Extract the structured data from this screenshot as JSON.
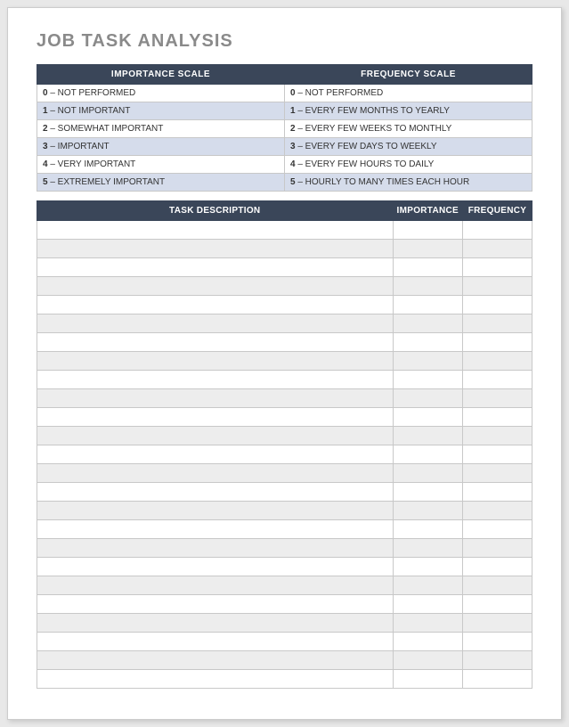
{
  "title": "JOB TASK ANALYSIS",
  "scales": {
    "importance_header": "IMPORTANCE SCALE",
    "frequency_header": "FREQUENCY SCALE",
    "rows": [
      {
        "imp_num": "0",
        "imp_text": " – NOT PERFORMED",
        "freq_num": "0",
        "freq_text": " – NOT PERFORMED",
        "alt": false
      },
      {
        "imp_num": "1",
        "imp_text": " – NOT IMPORTANT",
        "freq_num": "1",
        "freq_text": " – EVERY FEW MONTHS TO YEARLY",
        "alt": true
      },
      {
        "imp_num": "2",
        "imp_text": " – SOMEWHAT IMPORTANT",
        "freq_num": "2",
        "freq_text": " – EVERY FEW WEEKS TO MONTHLY",
        "alt": false
      },
      {
        "imp_num": "3",
        "imp_text": " – IMPORTANT",
        "freq_num": "3",
        "freq_text": " – EVERY FEW DAYS TO WEEKLY",
        "alt": true
      },
      {
        "imp_num": "4",
        "imp_text": " – VERY IMPORTANT",
        "freq_num": "4",
        "freq_text": " – EVERY FEW HOURS TO DAILY",
        "alt": false
      },
      {
        "imp_num": "5",
        "imp_text": " – EXTREMELY IMPORTANT",
        "freq_num": "5",
        "freq_text": " – HOURLY TO MANY TIMES EACH HOUR",
        "alt": true
      }
    ]
  },
  "tasks": {
    "header_desc": "TASK DESCRIPTION",
    "header_importance": "IMPORTANCE",
    "header_frequency": "FREQUENCY",
    "rows": [
      {
        "desc": "",
        "importance": "",
        "frequency": "",
        "alt": false
      },
      {
        "desc": "",
        "importance": "",
        "frequency": "",
        "alt": true
      },
      {
        "desc": "",
        "importance": "",
        "frequency": "",
        "alt": false
      },
      {
        "desc": "",
        "importance": "",
        "frequency": "",
        "alt": true
      },
      {
        "desc": "",
        "importance": "",
        "frequency": "",
        "alt": false
      },
      {
        "desc": "",
        "importance": "",
        "frequency": "",
        "alt": true
      },
      {
        "desc": "",
        "importance": "",
        "frequency": "",
        "alt": false
      },
      {
        "desc": "",
        "importance": "",
        "frequency": "",
        "alt": true
      },
      {
        "desc": "",
        "importance": "",
        "frequency": "",
        "alt": false
      },
      {
        "desc": "",
        "importance": "",
        "frequency": "",
        "alt": true
      },
      {
        "desc": "",
        "importance": "",
        "frequency": "",
        "alt": false
      },
      {
        "desc": "",
        "importance": "",
        "frequency": "",
        "alt": true
      },
      {
        "desc": "",
        "importance": "",
        "frequency": "",
        "alt": false
      },
      {
        "desc": "",
        "importance": "",
        "frequency": "",
        "alt": true
      },
      {
        "desc": "",
        "importance": "",
        "frequency": "",
        "alt": false
      },
      {
        "desc": "",
        "importance": "",
        "frequency": "",
        "alt": true
      },
      {
        "desc": "",
        "importance": "",
        "frequency": "",
        "alt": false
      },
      {
        "desc": "",
        "importance": "",
        "frequency": "",
        "alt": true
      },
      {
        "desc": "",
        "importance": "",
        "frequency": "",
        "alt": false
      },
      {
        "desc": "",
        "importance": "",
        "frequency": "",
        "alt": true
      },
      {
        "desc": "",
        "importance": "",
        "frequency": "",
        "alt": false
      },
      {
        "desc": "",
        "importance": "",
        "frequency": "",
        "alt": true
      },
      {
        "desc": "",
        "importance": "",
        "frequency": "",
        "alt": false
      },
      {
        "desc": "",
        "importance": "",
        "frequency": "",
        "alt": true
      },
      {
        "desc": "",
        "importance": "",
        "frequency": "",
        "alt": false
      }
    ]
  }
}
